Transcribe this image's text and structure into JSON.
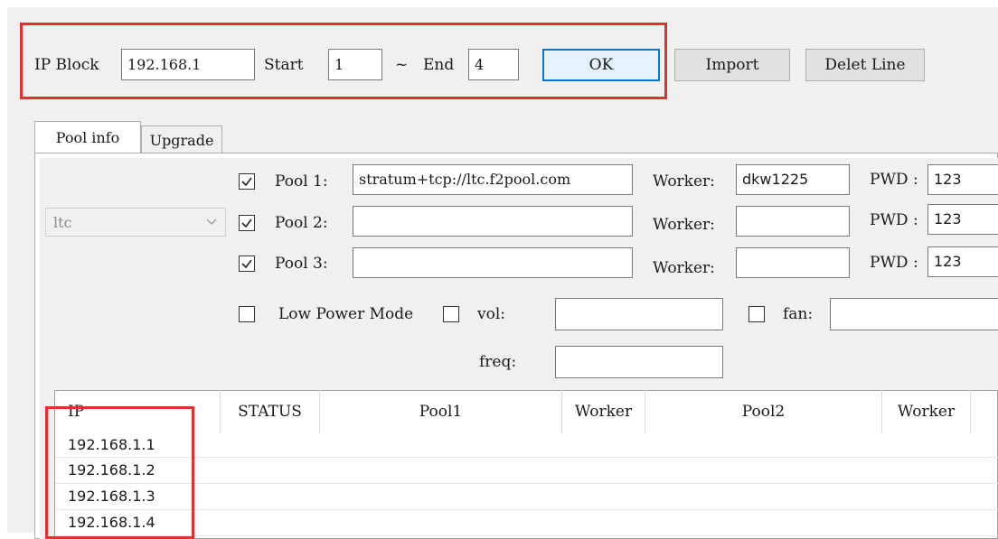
{
  "toolbar": {
    "ip_block_label": "IP Block",
    "ip_block_value": "192.168.1",
    "start_label": "Start",
    "start_value": "1",
    "range_sep": "~",
    "end_label": "End",
    "end_value": "4",
    "ok_label": "OK",
    "import_label": "Import",
    "delete_label": "Delet Line"
  },
  "tabs": [
    {
      "label": "Pool info",
      "active": true
    },
    {
      "label": "Upgrade",
      "active": false
    }
  ],
  "coin": {
    "selected": "ltc"
  },
  "pools": [
    {
      "label": "Pool 1:",
      "checked": true,
      "url": "stratum+tcp://ltc.f2pool.com",
      "worker_label": "Worker:",
      "worker": "dkw1225",
      "pwd_label": "PWD :",
      "pwd": "123"
    },
    {
      "label": "Pool 2:",
      "checked": true,
      "url": "",
      "worker_label": "Worker:",
      "worker": "",
      "pwd_label": "PWD :",
      "pwd": "123"
    },
    {
      "label": "Pool 3:",
      "checked": true,
      "url": "",
      "worker_label": "Worker:",
      "worker": "",
      "pwd_label": "PWD :",
      "pwd": "123"
    }
  ],
  "options": {
    "low_power_label": "Low Power Mode",
    "low_power_checked": false,
    "vol_label": "vol:",
    "vol_checked": false,
    "vol_value": "",
    "fan_label": "fan:",
    "fan_checked": false,
    "fan_value": "",
    "freq_label": "freq:",
    "freq_value": ""
  },
  "table": {
    "columns": [
      "IP",
      "STATUS",
      "Pool1",
      "Worker",
      "Pool2",
      "Worker"
    ],
    "rows": [
      {
        "ip": "192.168.1.1"
      },
      {
        "ip": "192.168.1.2"
      },
      {
        "ip": "192.168.1.3"
      },
      {
        "ip": "192.168.1.4"
      }
    ]
  },
  "colors": {
    "highlight": "#e03030",
    "focus": "#0078d7"
  }
}
